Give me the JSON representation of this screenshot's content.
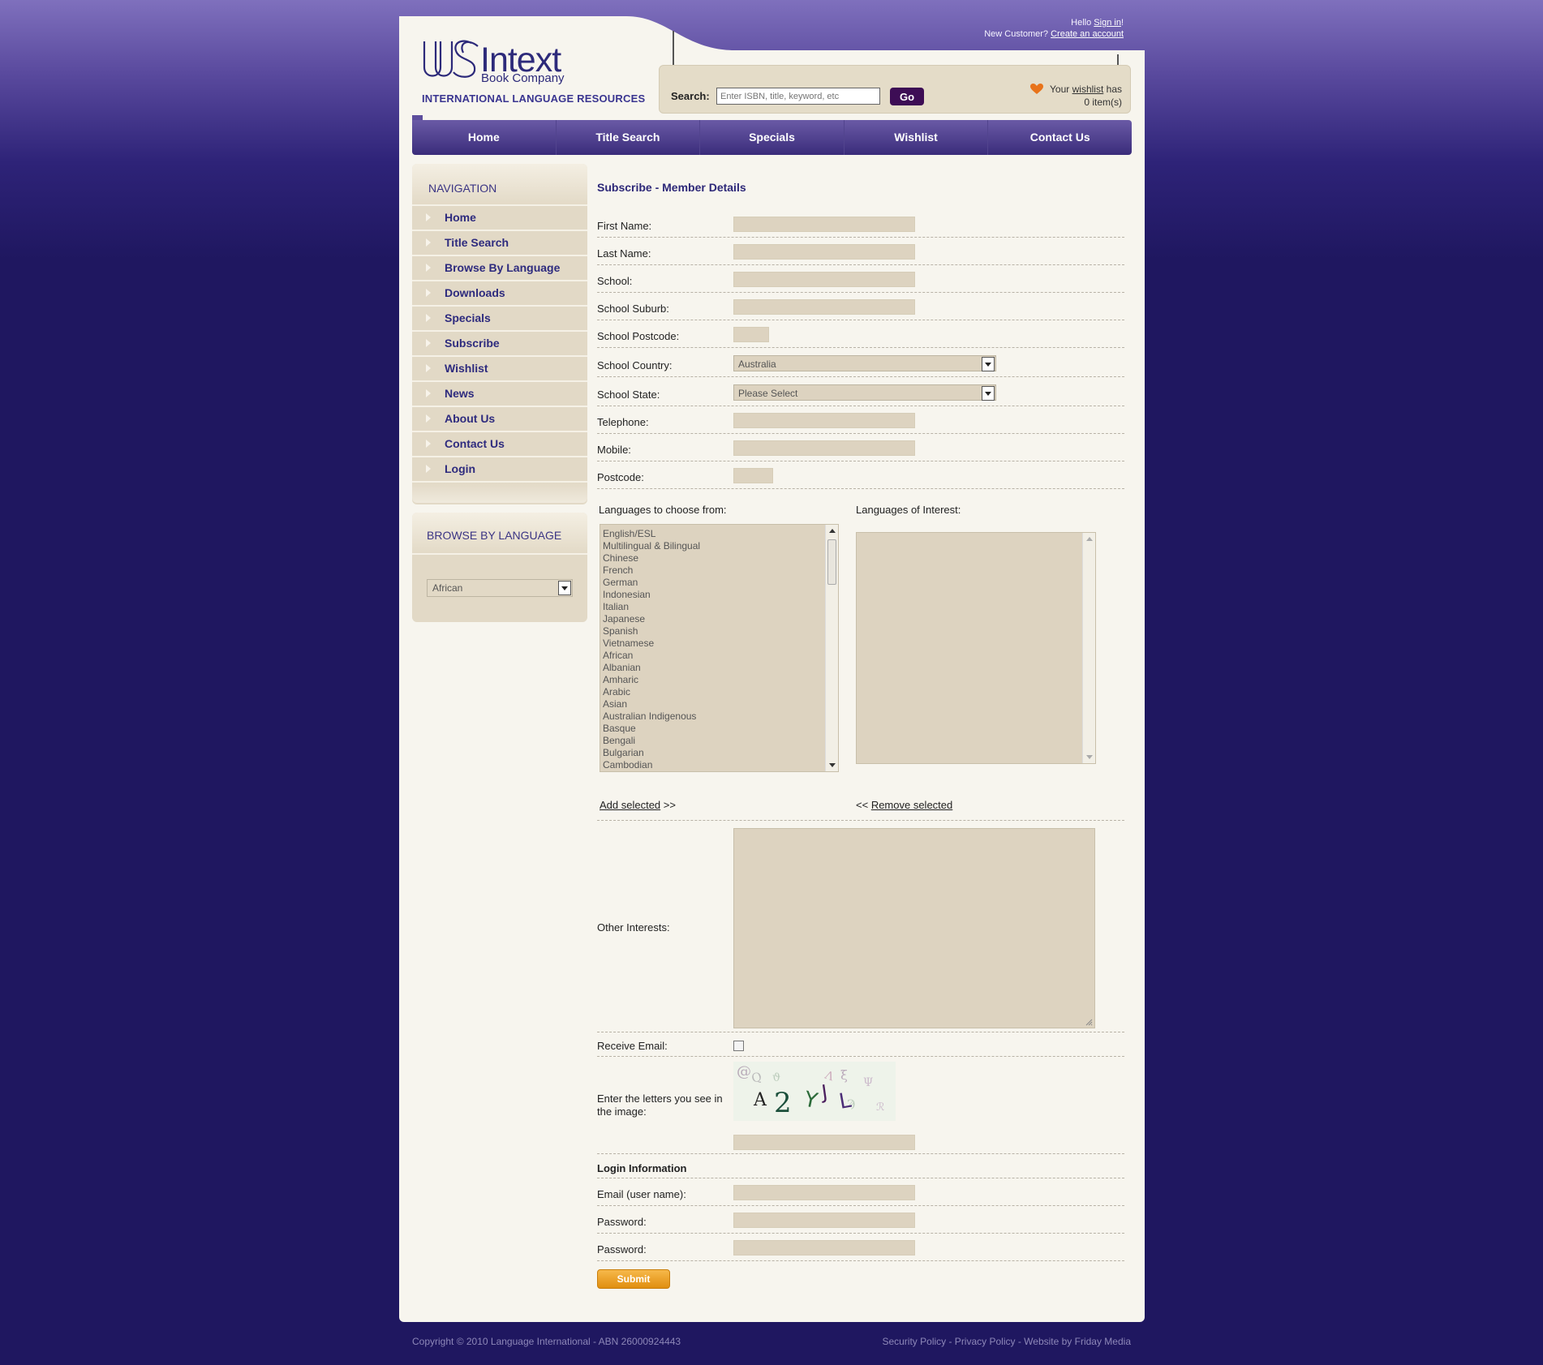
{
  "header": {
    "logo_intext": "Intext",
    "logo_book": "Book Company",
    "tagline": "INTERNATIONAL LANGUAGE RESOURCES",
    "hello": "Hello",
    "sign_in": "Sign in",
    "excl": "!",
    "new_customer": "New Customer?",
    "create_account": "Create an account"
  },
  "search": {
    "label": "Search:",
    "placeholder": "Enter ISBN, title, keyword, etc",
    "go_label": "Go"
  },
  "wishlist": {
    "your": "Your",
    "link": "wishlist",
    "has": "has",
    "count": "0 item(s)"
  },
  "topnav": [
    "Home",
    "Title Search",
    "Specials",
    "Wishlist",
    "Contact Us"
  ],
  "sidebar": {
    "nav_title": "NAVIGATION",
    "items": [
      "Home",
      "Title Search",
      "Browse By Language",
      "Downloads",
      "Specials",
      "Subscribe",
      "Wishlist",
      "News",
      "About Us",
      "Contact Us",
      "Login"
    ],
    "browse_title": "BROWSE BY LANGUAGE",
    "browse_value": "African"
  },
  "form": {
    "title": "Subscribe - Member Details",
    "first_name": "First Name:",
    "last_name": "Last Name:",
    "school": "School:",
    "school_suburb": "School Suburb:",
    "school_postcode": "School Postcode:",
    "school_country": "School Country:",
    "school_country_value": "Australia",
    "school_state": "School State:",
    "school_state_value": "Please Select",
    "telephone": "Telephone:",
    "mobile": "Mobile:",
    "postcode": "Postcode:",
    "languages_choose": "Languages to choose from:",
    "languages_interest": "Languages of Interest:",
    "language_options": [
      "English/ESL",
      "Multilingual & Bilingual",
      "Chinese",
      "French",
      "German",
      "Indonesian",
      "Italian",
      "Japanese",
      "Spanish",
      "Vietnamese",
      "African",
      "Albanian",
      "Amharic",
      "Arabic",
      "Asian",
      "Australian Indigenous",
      "Basque",
      "Bengali",
      "Bulgarian",
      "Cambodian"
    ],
    "add_selected": "Add selected",
    "add_arrows": ">>",
    "remove_arrows": "<<",
    "remove_selected": "Remove selected",
    "other_interests": "Other Interests:",
    "receive_email": "Receive Email:",
    "captcha_label": "Enter the letters you see in the image:",
    "captcha_text": "A2YJL",
    "login_info": "Login Information",
    "email": "Email (user name):",
    "password": "Password:",
    "password2": "Password:",
    "submit": "Submit"
  },
  "footer": {
    "copyright": "Copyright © 2010 Language International - ABN 26000924443",
    "links": "Security Policy - Privacy Policy - Website by Friday Media"
  },
  "colors": {
    "brand_purple": "#3b3584",
    "nav_purple": "#4a3c8a",
    "form_field": "#ddd3c0",
    "submit_orange": "#e9a020"
  }
}
